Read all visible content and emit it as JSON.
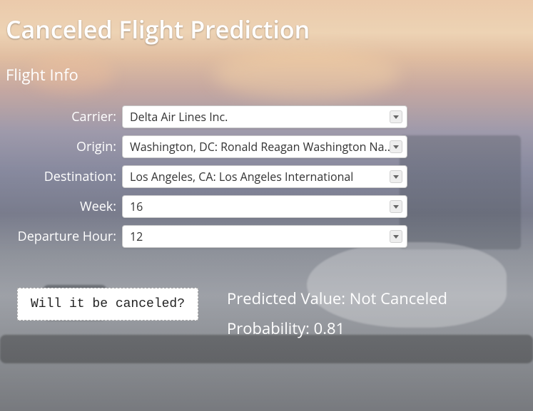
{
  "title": "Canceled Flight Prediction",
  "section": "Flight Info",
  "form": {
    "carrier": {
      "label": "Carrier:",
      "value": "Delta Air Lines Inc."
    },
    "origin": {
      "label": "Origin:",
      "value": "Washington, DC: Ronald Reagan Washington Na..."
    },
    "dest": {
      "label": "Destination:",
      "value": "Los Angeles, CA: Los Angeles International"
    },
    "week": {
      "label": "Week:",
      "value": "16"
    },
    "dep_hour": {
      "label": "Departure Hour:",
      "value": "12"
    }
  },
  "button": {
    "label": "Will it be canceled?"
  },
  "result": {
    "predicted_label": "Predicted Value: ",
    "predicted_value": "Not Canceled",
    "probability_label": "Probability: ",
    "probability_value": "0.81"
  }
}
